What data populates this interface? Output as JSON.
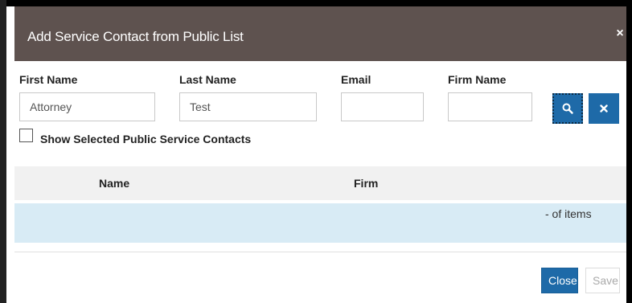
{
  "dialog": {
    "title": "Add Service Contact from Public List",
    "close_icon": "×"
  },
  "search": {
    "first_name": {
      "label": "First Name",
      "value": "Attorney"
    },
    "last_name": {
      "label": "Last Name",
      "value": "Test"
    },
    "email": {
      "label": "Email",
      "value": ""
    },
    "firm_name": {
      "label": "Firm Name",
      "value": ""
    },
    "search_button_icon": "search-icon",
    "clear_button_icon": "close-icon"
  },
  "filter": {
    "checkbox_label": "Show Selected Public Service Contacts",
    "checked": false
  },
  "grid": {
    "columns": [
      "Name",
      "Firm"
    ],
    "rows": [],
    "pager_info": "- of items"
  },
  "footer": {
    "close_label": "Close",
    "save_label": "Save"
  },
  "colors": {
    "header_bg": "#5e524f",
    "primary": "#1e6aa8",
    "row_bg": "#d8ebf5"
  }
}
